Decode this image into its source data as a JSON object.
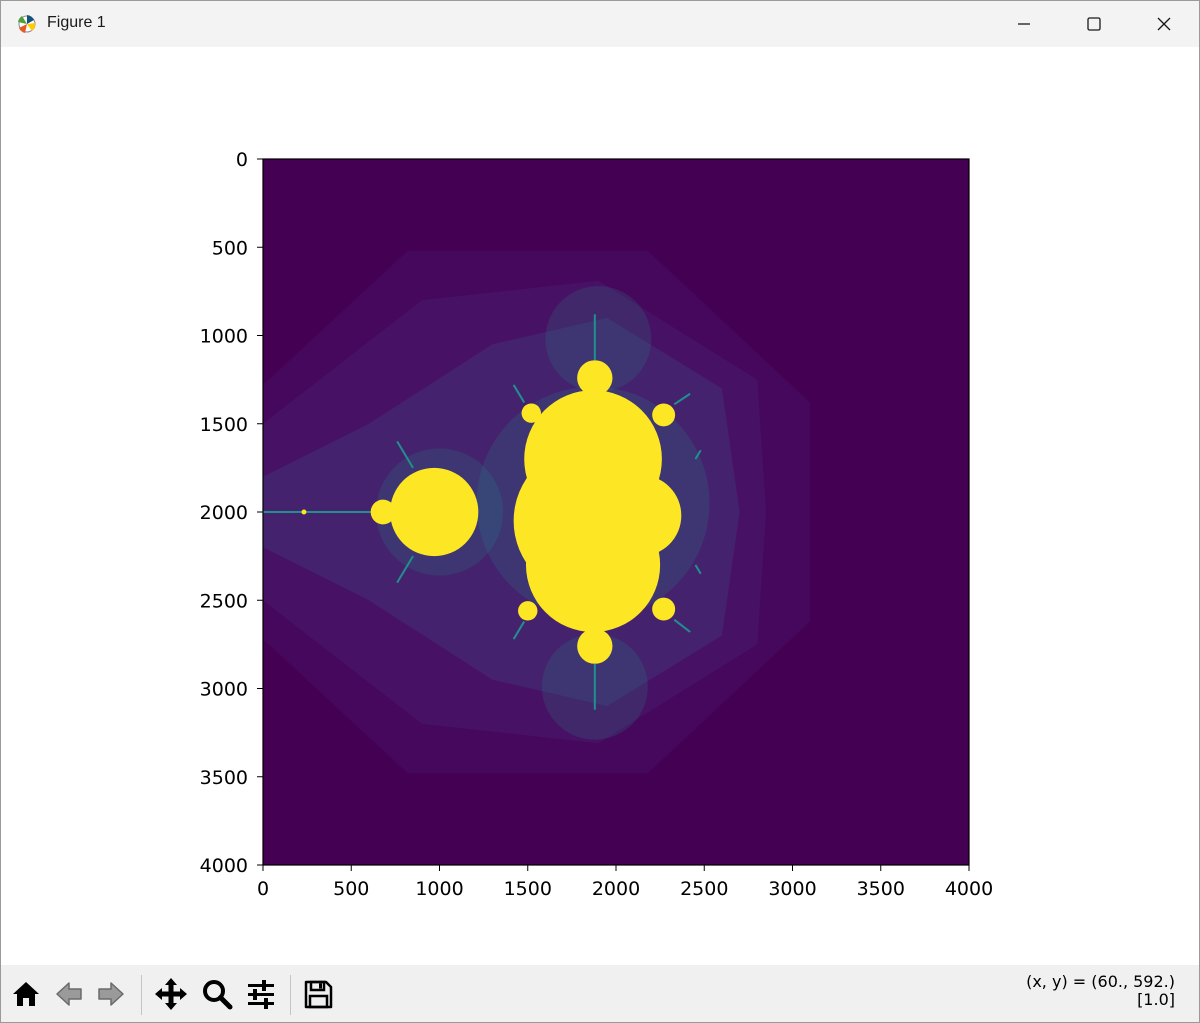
{
  "window": {
    "title": "Figure 1",
    "minimize_icon": "minimize-icon",
    "maximize_icon": "maximize-icon",
    "close_icon": "close-icon"
  },
  "chart_data": {
    "type": "heatmap",
    "title": "",
    "xlabel": "",
    "ylabel": "",
    "xlim": [
      0,
      4000
    ],
    "ylim": [
      4000,
      0
    ],
    "image_size": [
      4000,
      4000
    ],
    "colormap": "viridis",
    "content": "Mandelbrot set escape-time image",
    "x_ticks": [
      "0",
      "500",
      "1000",
      "1500",
      "2000",
      "2500",
      "3000",
      "3500",
      "4000"
    ],
    "y_ticks": [
      "0",
      "500",
      "1000",
      "1500",
      "2000",
      "2500",
      "3000",
      "3500",
      "4000"
    ],
    "colors": {
      "background": "#440154",
      "set": "#fde725",
      "band1": "#46085c",
      "band2": "#471265",
      "band3": "#45226e",
      "edge": "#21908d"
    }
  },
  "toolbar": {
    "items": [
      {
        "name": "home-button",
        "icon": "home-icon"
      },
      {
        "name": "back-button",
        "icon": "arrow-left-icon"
      },
      {
        "name": "forward-button",
        "icon": "arrow-right-icon"
      },
      {
        "name": "pan-button",
        "icon": "move-icon"
      },
      {
        "name": "zoom-button",
        "icon": "magnifier-icon"
      },
      {
        "name": "configure-subplots-button",
        "icon": "sliders-icon"
      },
      {
        "name": "save-button",
        "icon": "floppy-disk-icon"
      }
    ],
    "coords_line1": "(x, y) = (60., 592.)",
    "coords_line2": "[1.0]"
  }
}
